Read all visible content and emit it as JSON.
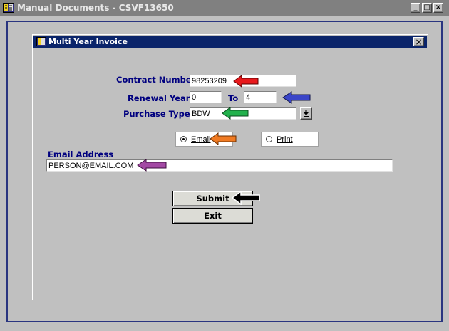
{
  "window": {
    "title": "Manual Documents - CSVF13650",
    "buttons": {
      "minimize": "_",
      "maximize": "□",
      "close": "×"
    }
  },
  "dialog": {
    "title": "Multi Year Invoice",
    "close": "×"
  },
  "form": {
    "contract_number": {
      "label": "Contract Number",
      "value": "98253209"
    },
    "renewal_year": {
      "label": "Renewal Year",
      "from": "0",
      "to_label": "To",
      "to": "4"
    },
    "purchase_type": {
      "label": "Purchase Type",
      "value": "BDW",
      "dropdown_icon": "dropdown-arrow-icon"
    },
    "delivery": {
      "options": [
        {
          "label": "Email",
          "selected": true
        },
        {
          "label": "Print",
          "selected": false
        }
      ]
    },
    "email_address": {
      "label": "Email Address",
      "value": "PERSON@EMAIL.COM"
    }
  },
  "buttons": {
    "submit": "Submit",
    "exit": "Exit"
  },
  "annotations": {
    "arrows": [
      {
        "target": "contract-number",
        "color": "#e8191c"
      },
      {
        "target": "renewal-year-to",
        "color": "#3a45c8"
      },
      {
        "target": "purchase-type",
        "color": "#22b14c"
      },
      {
        "target": "email-option",
        "color": "#f07a22"
      },
      {
        "target": "email-address",
        "color": "#a349a4"
      },
      {
        "target": "submit-button",
        "color": "#000000"
      }
    ]
  }
}
